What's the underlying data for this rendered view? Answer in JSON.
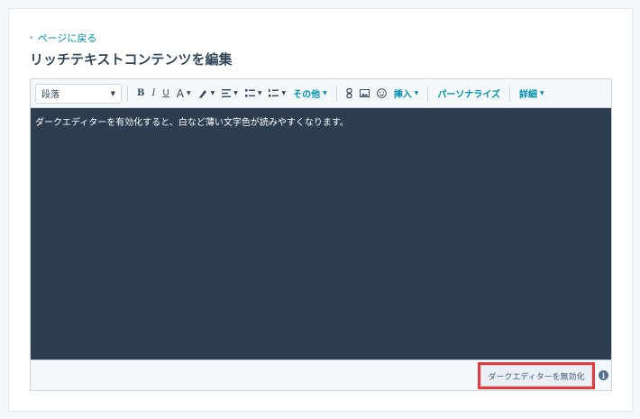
{
  "nav": {
    "back_label": "ページに戻る",
    "back_chevron": "‹"
  },
  "page": {
    "title": "リッチテキストコンテンツを編集"
  },
  "toolbar": {
    "paragraph_select": "段落",
    "bold": "B",
    "italic": "I",
    "underline": "U",
    "font_color": "A",
    "more": "その他",
    "insert": "挿入",
    "personalize": "パーソナライズ",
    "advanced": "詳細"
  },
  "editor": {
    "content_text": "ダークエディターを有効化すると、白など薄い文字色が読みやすくなります。",
    "background_color": "#2d3e50"
  },
  "footer": {
    "disable_dark_editor": "ダークエディターを無効化",
    "info": "i"
  },
  "colors": {
    "accent": "#0091ae",
    "highlight": "#e33b3b",
    "text": "#33475b"
  }
}
